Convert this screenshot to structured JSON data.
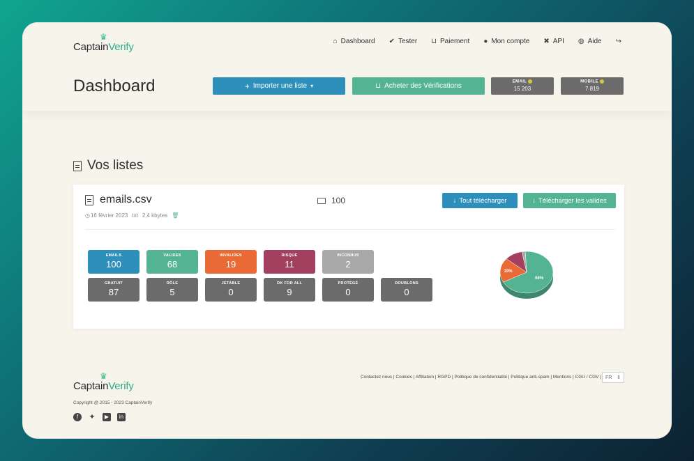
{
  "brand": {
    "name_a": "Captain",
    "name_b": "Verify"
  },
  "nav": {
    "items": [
      {
        "label": "Dashboard",
        "icon": "home-icon",
        "glyph": "⌂"
      },
      {
        "label": "Tester",
        "icon": "check-circle-icon",
        "glyph": "✔"
      },
      {
        "label": "Paiement",
        "icon": "basket-icon",
        "glyph": "🧺"
      },
      {
        "label": "Mon compte",
        "icon": "user-icon",
        "glyph": "👤"
      },
      {
        "label": "API",
        "icon": "tools-icon",
        "glyph": "✖"
      },
      {
        "label": "Aide",
        "icon": "globe-icon",
        "glyph": "◍"
      }
    ],
    "logout_icon": "logout-icon"
  },
  "header": {
    "title": "Dashboard",
    "import_label": "Importer une liste",
    "buy_label": "Acheter des Vérifications",
    "credits": {
      "email": {
        "label": "EMAIL",
        "value": "15 203"
      },
      "mobile": {
        "label": "MOBILE",
        "value": "7 819"
      }
    }
  },
  "lists": {
    "section_title": "Vos listes",
    "file": {
      "name": "emails.csv",
      "date": "16 février 2023",
      "type": "txt",
      "size": "2,4 kbytes",
      "count": "100",
      "download_all_label": "Tout télécharger",
      "download_valid_label": "Télécharger les valides"
    },
    "stats_row1": [
      {
        "label": "EMAILS",
        "value": "100",
        "color": "#2e8fbb"
      },
      {
        "label": "VALIDES",
        "value": "68",
        "color": "#53b393"
      },
      {
        "label": "INVALIDES",
        "value": "19",
        "color": "#ea6a35"
      },
      {
        "label": "RISQUÉ",
        "value": "11",
        "color": "#a3405f"
      },
      {
        "label": "INCONNUS",
        "value": "2",
        "color": "#a8a8a8"
      }
    ],
    "stats_row2": [
      {
        "label": "GRATUIT",
        "value": "87",
        "color": "#6b6b6b"
      },
      {
        "label": "RÔLE",
        "value": "5",
        "color": "#6b6b6b"
      },
      {
        "label": "JETABLE",
        "value": "0",
        "color": "#6b6b6b"
      },
      {
        "label": "OK FOR ALL",
        "value": "9",
        "color": "#6b6b6b"
      },
      {
        "label": "PROTÉGÉ",
        "value": "0",
        "color": "#6b6b6b"
      },
      {
        "label": "DOUBLONS",
        "value": "0",
        "color": "#6b6b6b"
      }
    ]
  },
  "chart_data": {
    "type": "pie",
    "slices": [
      {
        "name": "VALIDES",
        "value": 68,
        "label": "68%",
        "color": "#53b393"
      },
      {
        "name": "INVALIDES",
        "value": 19,
        "label": "19%",
        "color": "#ea6a35"
      },
      {
        "name": "RISQUÉ",
        "value": 11,
        "label": "",
        "color": "#a3405f"
      },
      {
        "name": "INCONNUS",
        "value": 2,
        "label": "",
        "color": "#a8a8a8"
      }
    ]
  },
  "footer": {
    "copyright": "Copyright @ 2015 - 2023 CaptainVerify",
    "links": "Contactez nous | Cookies | Affiliation | RGPD | Politique de confidentialité | Politique anti-spam | Mentions | CGU / CGV |",
    "lang": "FR",
    "social": [
      "facebook-icon",
      "twitter-icon",
      "youtube-icon",
      "linkedin-icon"
    ]
  }
}
